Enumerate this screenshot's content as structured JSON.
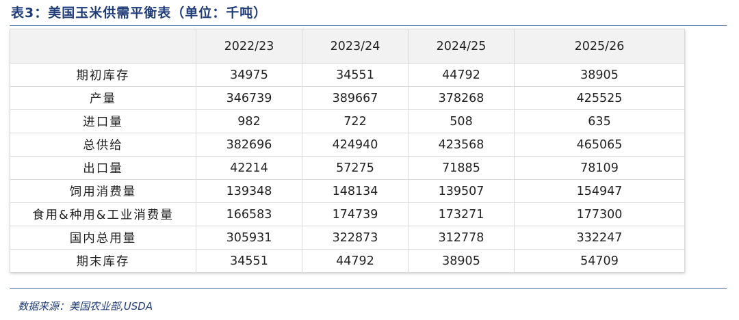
{
  "title": "表3：美国玉米供需平衡表（单位：千吨）",
  "table": {
    "header": [
      "",
      "2022/23",
      "2023/24",
      "2024/25",
      "2025/26"
    ],
    "rows": [
      {
        "label": "期初库存",
        "values": [
          "34975",
          "34551",
          "44792",
          "38905"
        ]
      },
      {
        "label": "产量",
        "values": [
          "346739",
          "389667",
          "378268",
          "425525"
        ]
      },
      {
        "label": "进口量",
        "values": [
          "982",
          "722",
          "508",
          "635"
        ]
      },
      {
        "label": "总供给",
        "values": [
          "382696",
          "424940",
          "423568",
          "465065"
        ]
      },
      {
        "label": "出口量",
        "values": [
          "42214",
          "57275",
          "71885",
          "78109"
        ]
      },
      {
        "label": "饲用消费量",
        "values": [
          "139348",
          "148134",
          "139507",
          "154947"
        ]
      },
      {
        "label": "食用&种用&工业消费量",
        "values": [
          "166583",
          "174739",
          "173271",
          "177300"
        ]
      },
      {
        "label": "国内总用量",
        "values": [
          "305931",
          "322873",
          "312778",
          "332247"
        ]
      },
      {
        "label": "期末库存",
        "values": [
          "34551",
          "44792",
          "38905",
          "54709"
        ]
      }
    ]
  },
  "source": "数据来源：美国农业部,USDA",
  "colors": {
    "accent": "#1f3c78",
    "rule": "#4e6fa8",
    "header_bg": "#f2f2f2",
    "grid": "#d9d9d9"
  }
}
